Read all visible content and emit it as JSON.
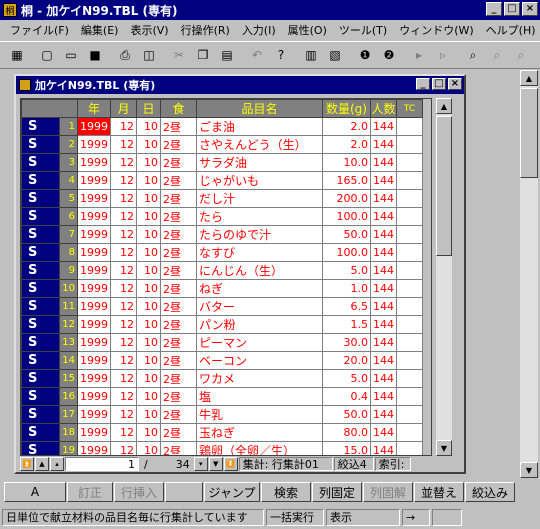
{
  "window": {
    "title": "桐 - 加ケイN99.TBL (専有)"
  },
  "menu": [
    "ファイル(F)",
    "編集(E)",
    "表示(V)",
    "行操作(R)",
    "入力(I)",
    "属性(O)",
    "ツール(T)",
    "ウィンドウ(W)",
    "ヘルプ(H)"
  ],
  "child": {
    "title": "加ケイN99.TBL (専有)"
  },
  "grid": {
    "columns": [
      "年",
      "月",
      "日",
      "食",
      "品目名",
      "数量(g)",
      "人数",
      "TC"
    ],
    "rows": [
      {
        "n": "1",
        "year": "1999",
        "month": "12",
        "day": "10",
        "meal": "2昼",
        "item": "ごま油",
        "qty": "2.0",
        "people": "144"
      },
      {
        "n": "2",
        "year": "1999",
        "month": "12",
        "day": "10",
        "meal": "2昼",
        "item": "さやえんどう（生）",
        "qty": "2.0",
        "people": "144"
      },
      {
        "n": "3",
        "year": "1999",
        "month": "12",
        "day": "10",
        "meal": "2昼",
        "item": "サラダ油",
        "qty": "10.0",
        "people": "144"
      },
      {
        "n": "4",
        "year": "1999",
        "month": "12",
        "day": "10",
        "meal": "2昼",
        "item": "じゃがいも",
        "qty": "165.0",
        "people": "144"
      },
      {
        "n": "5",
        "year": "1999",
        "month": "12",
        "day": "10",
        "meal": "2昼",
        "item": "だし汁",
        "qty": "200.0",
        "people": "144"
      },
      {
        "n": "6",
        "year": "1999",
        "month": "12",
        "day": "10",
        "meal": "2昼",
        "item": "たら",
        "qty": "100.0",
        "people": "144"
      },
      {
        "n": "7",
        "year": "1999",
        "month": "12",
        "day": "10",
        "meal": "2昼",
        "item": "たらのゆで汁",
        "qty": "50.0",
        "people": "144"
      },
      {
        "n": "8",
        "year": "1999",
        "month": "12",
        "day": "10",
        "meal": "2昼",
        "item": "なすび",
        "qty": "100.0",
        "people": "144"
      },
      {
        "n": "9",
        "year": "1999",
        "month": "12",
        "day": "10",
        "meal": "2昼",
        "item": "にんじん（生）",
        "qty": "5.0",
        "people": "144"
      },
      {
        "n": "10",
        "year": "1999",
        "month": "12",
        "day": "10",
        "meal": "2昼",
        "item": "ねぎ",
        "qty": "1.0",
        "people": "144"
      },
      {
        "n": "11",
        "year": "1999",
        "month": "12",
        "day": "10",
        "meal": "2昼",
        "item": "バター",
        "qty": "6.5",
        "people": "144"
      },
      {
        "n": "12",
        "year": "1999",
        "month": "12",
        "day": "10",
        "meal": "2昼",
        "item": "パン粉",
        "qty": "1.5",
        "people": "144"
      },
      {
        "n": "13",
        "year": "1999",
        "month": "12",
        "day": "10",
        "meal": "2昼",
        "item": "ピーマン",
        "qty": "30.0",
        "people": "144"
      },
      {
        "n": "14",
        "year": "1999",
        "month": "12",
        "day": "10",
        "meal": "2昼",
        "item": "ベーコン",
        "qty": "20.0",
        "people": "144"
      },
      {
        "n": "15",
        "year": "1999",
        "month": "12",
        "day": "10",
        "meal": "2昼",
        "item": "ワカメ",
        "qty": "5.0",
        "people": "144"
      },
      {
        "n": "16",
        "year": "1999",
        "month": "12",
        "day": "10",
        "meal": "2昼",
        "item": "塩",
        "qty": "0.4",
        "people": "144"
      },
      {
        "n": "17",
        "year": "1999",
        "month": "12",
        "day": "10",
        "meal": "2昼",
        "item": "牛乳",
        "qty": "50.0",
        "people": "144"
      },
      {
        "n": "18",
        "year": "1999",
        "month": "12",
        "day": "10",
        "meal": "2昼",
        "item": "玉ねぎ",
        "qty": "80.0",
        "people": "144"
      },
      {
        "n": "19",
        "year": "1999",
        "month": "12",
        "day": "10",
        "meal": "2昼",
        "item": "鶏卵（全卵／生）",
        "qty": "15.0",
        "people": "144"
      }
    ],
    "row_marker": "S"
  },
  "child_footer": {
    "current_row": "1",
    "separator": "/",
    "total_rows": "34",
    "aggregate": "集計: 行集計01",
    "filter": "絞込4",
    "index": "索引:"
  },
  "fkeys": [
    "A",
    "訂正",
    "行挿入",
    "",
    "ジャンプ",
    "検索",
    "列固定",
    "列固解",
    "並替え",
    "絞込み"
  ],
  "status": {
    "message": "日単位で献立材料の品目名毎に行集計しています",
    "batch": "一括実行",
    "mode": "表示",
    "arrow": "→"
  },
  "colors": {
    "titlebar": "#000080",
    "header_text": "#ffff00",
    "cell_text": "#ff0000",
    "face": "#c0c0c0"
  }
}
